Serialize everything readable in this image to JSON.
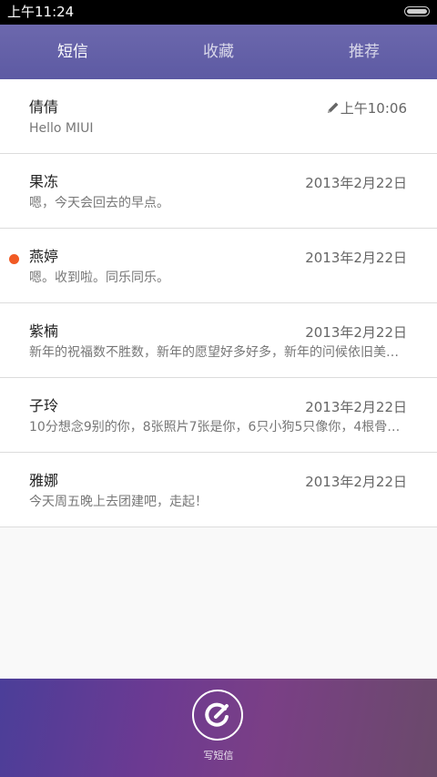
{
  "status_bar": {
    "time": "上午11:24"
  },
  "tabs": [
    {
      "label": "短信"
    },
    {
      "label": "收藏"
    },
    {
      "label": "推荐"
    }
  ],
  "messages": [
    {
      "name": "倩倩",
      "preview": "Hello MIUI",
      "date": "上午10:06",
      "draft": true,
      "unread": false
    },
    {
      "name": "果冻",
      "preview": "嗯，今天会回去的早点。",
      "date": "2013年2月22日",
      "draft": false,
      "unread": false
    },
    {
      "name": "燕婷",
      "preview": "嗯。收到啦。同乐同乐。",
      "date": "2013年2月22日",
      "draft": false,
      "unread": true
    },
    {
      "name": "紫楠",
      "preview": "新年的祝福数不胜数，新年的愿望好多好多，新年的问候依旧美好…",
      "date": "2013年2月22日",
      "draft": false,
      "unread": false
    },
    {
      "name": "子玲",
      "preview": "10分想念9别的你，8张照片7张是你，6只小狗5只像你，4根骨头…",
      "date": "2013年2月22日",
      "draft": false,
      "unread": false
    },
    {
      "name": "雅娜",
      "preview": "今天周五晚上去团建吧，走起！",
      "date": "2013年2月22日",
      "draft": false,
      "unread": false
    }
  ],
  "bottom_bar": {
    "compose_label": "写短信"
  },
  "colors": {
    "header": "#5d5aa3",
    "unread_dot": "#f15a24",
    "status_bar": "#000000"
  }
}
